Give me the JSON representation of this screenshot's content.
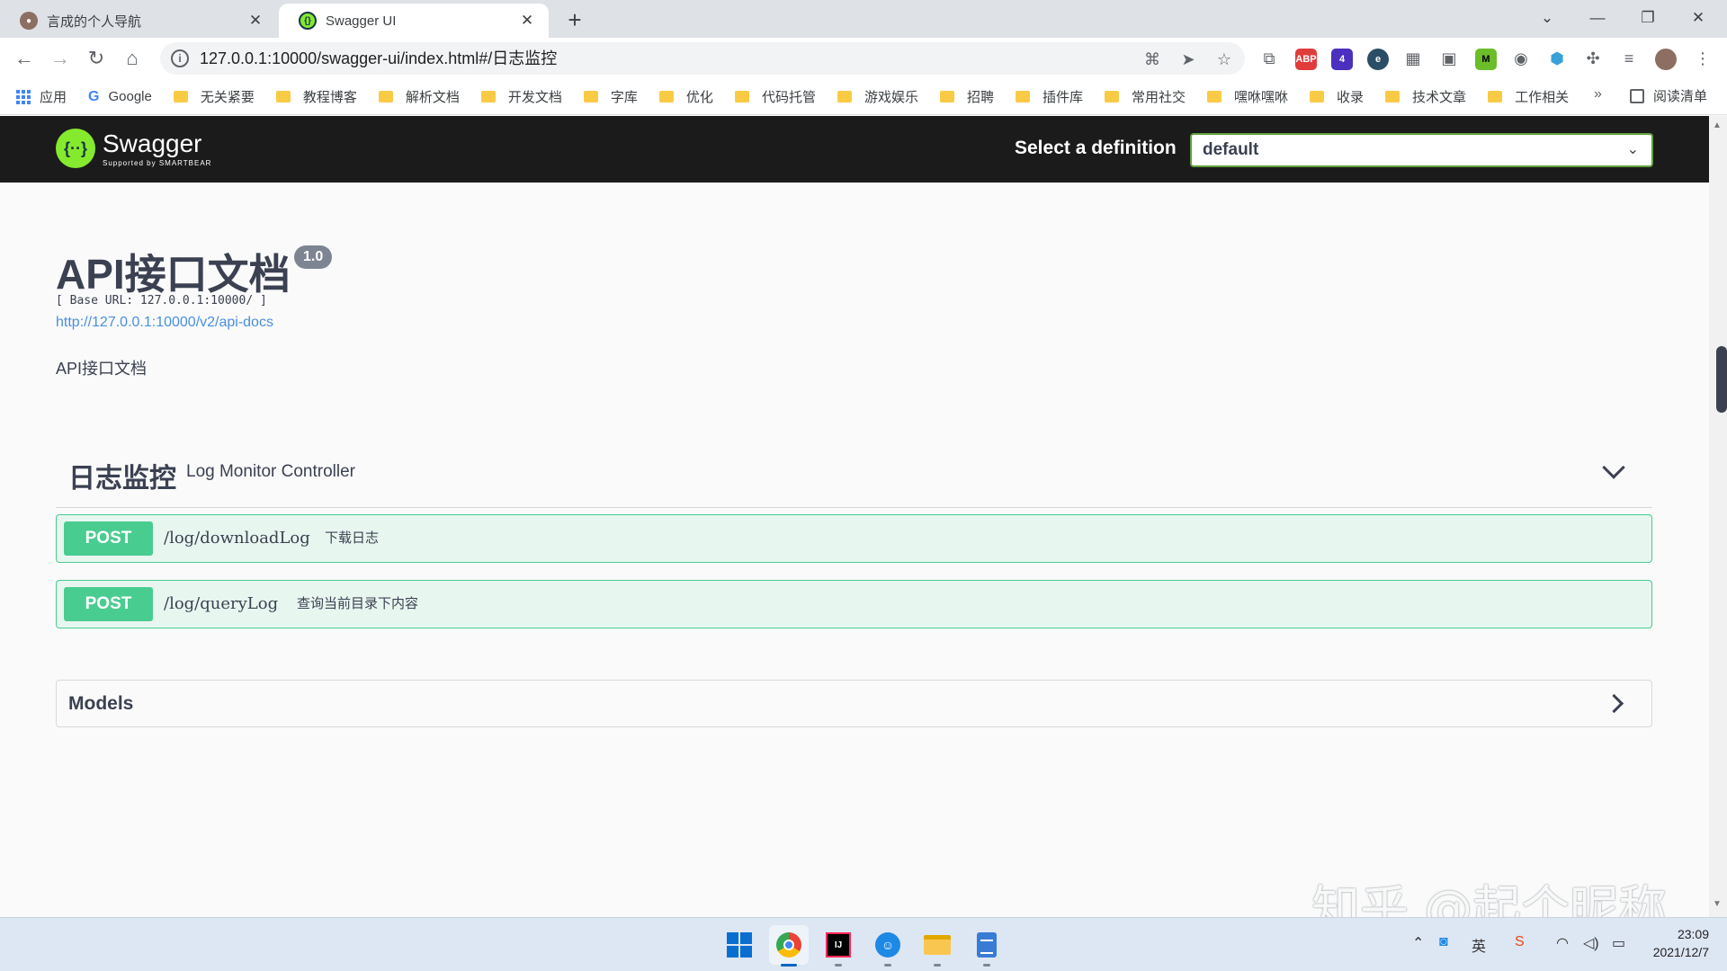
{
  "browser": {
    "tabs": [
      {
        "title": "言成的个人导航"
      },
      {
        "title": "Swagger UI"
      }
    ],
    "new_tab": "+",
    "url": "127.0.0.1:10000/swagger-ui/index.html#/日志监控",
    "bookmarks": [
      "应用",
      "Google",
      "无关紧要",
      "教程博客",
      "解析文档",
      "开发文档",
      "字库",
      "优化",
      "代码托管",
      "游戏娱乐",
      "招聘",
      "插件库",
      "常用社交",
      "嘿咻嘿咻",
      "收录",
      "技术文章",
      "工作相关"
    ],
    "bookmarks_more": "»",
    "reading_list": "阅读清单",
    "extensions": [
      {
        "label": "ABP",
        "color": "#e03c3c"
      },
      {
        "label": "4",
        "color": "#4b2fbf"
      },
      {
        "label": "e",
        "color": "#2b4d66"
      },
      {
        "label": "M",
        "color": "#6bbd2a"
      }
    ]
  },
  "swagger": {
    "logo_name": "Swagger",
    "logo_sub": "Supported by SMARTBEAR",
    "select_label": "Select a definition",
    "select_value": "default",
    "title": "API接口文档",
    "version": "1.0",
    "base_url": "[ Base URL: 127.0.0.1:10000/ ]",
    "docs_link": "http://127.0.0.1:10000/v2/api-docs",
    "description": "API接口文档",
    "tag": {
      "name": "日志监控",
      "description": "Log Monitor Controller"
    },
    "operations": [
      {
        "method": "POST",
        "path": "/log/downloadLog",
        "summary": "下载日志"
      },
      {
        "method": "POST",
        "path": "/log/queryLog",
        "summary": "查询当前目录下内容"
      }
    ],
    "models_label": "Models"
  },
  "watermark": "知乎 @起个昵称",
  "taskbar": {
    "time": "23:09",
    "date": "2021/12/7",
    "ime": "英"
  },
  "colors": {
    "post": "#49cc90",
    "post_bg": "#e8f6f0",
    "topbar": "#1b1b1b",
    "select_border": "#62a03f",
    "link": "#4990e2"
  }
}
